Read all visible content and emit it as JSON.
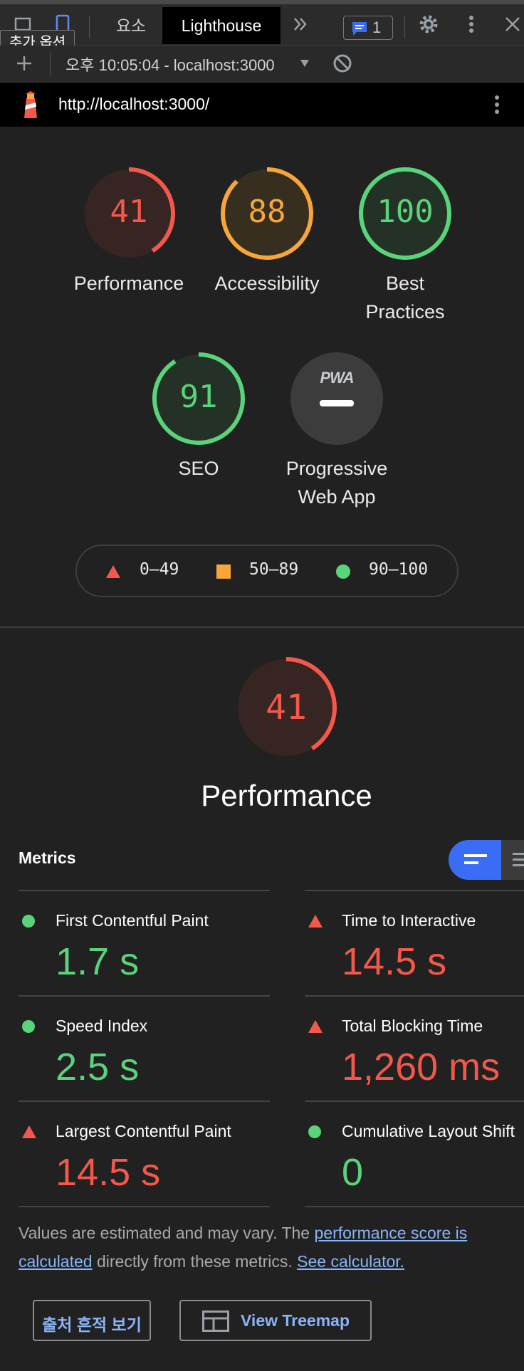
{
  "toolbar": {
    "tooltip": "추가 옵션",
    "tabs": [
      "요소",
      "Lighthouse"
    ],
    "issues_count": "1"
  },
  "runbar": {
    "report_selector": "오후 10:05:04 - localhost:3000"
  },
  "urlbar": {
    "url": "http://localhost:3000/"
  },
  "gauges": [
    {
      "score": "41",
      "label": "Performance",
      "value": 0.41,
      "color": "#f4584a"
    },
    {
      "score": "88",
      "label": "Accessibility",
      "value": 0.88,
      "color": "#f8a53a"
    },
    {
      "score": "100",
      "label": "Best Practices",
      "value": 1.0,
      "color": "#59d47a"
    },
    {
      "score": "91",
      "label": "SEO",
      "value": 0.91,
      "color": "#59d47a"
    },
    {
      "score": "PWA",
      "label": "Progressive Web App"
    }
  ],
  "legend": {
    "fail": "0–49",
    "average": "50–89",
    "pass": "90–100"
  },
  "performance": {
    "score": "41",
    "value": 0.41,
    "title": "Performance",
    "metrics_heading": "Metrics",
    "metrics": [
      {
        "title": "First Contentful Paint",
        "value": "1.7 s",
        "status": "pass"
      },
      {
        "title": "Time to Interactive",
        "value": "14.5 s",
        "status": "fail"
      },
      {
        "title": "Speed Index",
        "value": "2.5 s",
        "status": "pass"
      },
      {
        "title": "Total Blocking Time",
        "value": "1,260 ms",
        "status": "fail"
      },
      {
        "title": "Largest Contentful Paint",
        "value": "14.5 s",
        "status": "fail"
      },
      {
        "title": "Cumulative Layout Shift",
        "value": "0",
        "status": "pass"
      }
    ],
    "note_prefix": "Values are estimated and may vary. The",
    "note_link1": "performance score is calculated",
    "note_middle": "directly from these metrics.",
    "note_link2": "See calculator."
  },
  "buttons": {
    "trace": "출처 흔적 보기",
    "treemap": "View Treemap"
  },
  "colors": {
    "pass": "#59d47a",
    "average": "#f8a53a",
    "fail": "#f4584a",
    "accent": "#3b6cf5"
  }
}
